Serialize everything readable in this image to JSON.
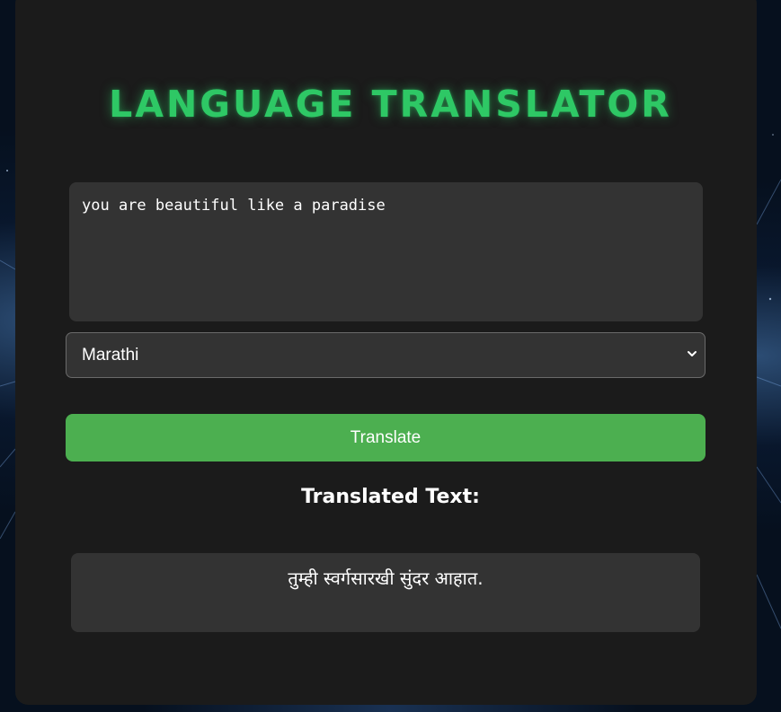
{
  "app": {
    "title": "LANGUAGE TRANSLATOR"
  },
  "input": {
    "value": "you are beautiful like a paradise",
    "placeholder": ""
  },
  "language_select": {
    "selected": "Marathi",
    "chevron_icon": "chevron-down-icon"
  },
  "translate_button": {
    "label": "Translate"
  },
  "result": {
    "heading": "Translated Text:",
    "text": "तुम्ही स्वर्गसारखी सुंदर आहात."
  },
  "colors": {
    "accent_green": "#4caf50",
    "title_green": "#2ec865",
    "card_bg": "#1b1b1b",
    "field_bg": "#333333"
  }
}
